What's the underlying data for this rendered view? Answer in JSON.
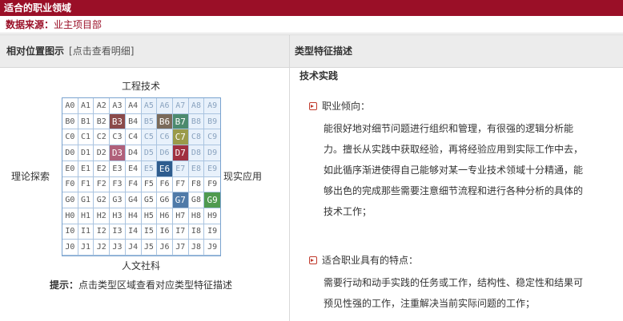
{
  "header": {
    "title": "适合的职业领域"
  },
  "source": {
    "label": "数据来源：",
    "value": "业主项目部"
  },
  "table_head": {
    "left_title": "相对位置图示",
    "left_hint": "[点击查看明细]",
    "right_title": "类型特征描述"
  },
  "axes": {
    "top": "工程技术",
    "bottom": "人文社科",
    "left": "理论探索",
    "right": "现实应用"
  },
  "grid": {
    "rows": [
      "A",
      "B",
      "C",
      "D",
      "E",
      "F",
      "G",
      "H",
      "I",
      "J"
    ],
    "cols": [
      "0",
      "1",
      "2",
      "3",
      "4",
      "5",
      "6",
      "7",
      "8",
      "9"
    ],
    "highlights": {
      "B3": "#8b4a4a",
      "B6": "#7a6a5a",
      "B7": "#4c8a6e",
      "C7": "#9a9a4a",
      "D3": "#b0607a",
      "D7": "#a03040",
      "E6": "#2e5c8e",
      "G7": "#4f7aa8",
      "G9": "#4f9a4f"
    }
  },
  "tip": {
    "label": "提示：",
    "text": "点击类型区域查看对应类型特征描述"
  },
  "description": {
    "type_title": "技术实践",
    "tendency_label": "职业倾向：",
    "tendency_lines": [
      "能很好地对细节问题进行组织和管理，有很强的逻辑分析能",
      "力。擅长从实践中获取经验，再将经验应用到实际工作中去，",
      "如此循序渐进使得自己能够对某一专业技术领域十分精通，能",
      "够出色的完成那些需要注意细节流程和进行各种分析的具体的",
      "技术工作；"
    ],
    "features_label": "适合职业具有的特点：",
    "features_lines": [
      "需要行动和动手实践的任务或工作，结构性、稳定性和结果可",
      "预见性强的工作，注重解决当前实际问题的工作；"
    ]
  }
}
